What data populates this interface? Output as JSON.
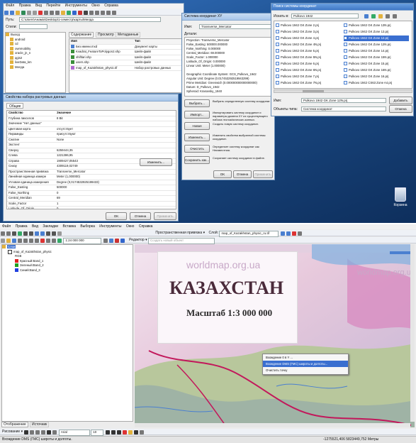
{
  "top": {
    "arccatalog": {
      "menu": [
        "Файл",
        "Правка",
        "Вид",
        "Перейти",
        "Инструменты",
        "Окно",
        "Справка"
      ],
      "path_label": "Путь:",
      "path_value": "C:\\Users\\Анаміх\\Desktop\\1-семестр\\карты\\Мелда",
      "styles_label": "Стили:",
      "tabs": [
        "Содержание",
        "Просмотр",
        "Метаданные"
      ],
      "tree": [
        "Выход",
        "android",
        "cd",
        "ownmobility",
        "oracle_jn_n",
        "qgis2",
        "liveData_km",
        "Мелда"
      ],
      "col_name": "Имя",
      "col_type": "Тип",
      "files": [
        {
          "name": "Без имени.mxd",
          "type": "Документ карты"
        },
        {
          "name": "Kvadrat_FeatureToPolygon2.shp",
          "type": "Шейп-файл"
        },
        {
          "name": "shiftlari.shp",
          "type": "Шейп-файл"
        },
        {
          "name": "users.shp",
          "type": "Шейп-файл"
        },
        {
          "name": "map_of_Kazakhstan_physic.tif",
          "type": "Набор растровых данных"
        }
      ]
    },
    "props": {
      "title": "Свойства набора растровых данных",
      "tab": "Общие",
      "col_prop": "Свойство",
      "col_val": "Значение",
      "rows": [
        {
          "k": "Глубина пикселов",
          "v": "8 Bit"
        },
        {
          "k": "Значение \"Нет данных\"",
          "v": ""
        },
        {
          "k": "Цветовая карта",
          "v": "отсутствует"
        },
        {
          "k": "Пирамиды",
          "v": "присутствуют"
        },
        {
          "k": "Сжатие",
          "v": "None"
        },
        {
          "k": "Экстент",
          "v": ""
        },
        {
          "k": "Сверху",
          "v": "6259444,35"
        },
        {
          "k": "Слева",
          "v": "1221386,95"
        },
        {
          "k": "Справа",
          "v": "1909427,05543"
        },
        {
          "k": "Снизу",
          "v": "4309119,02749"
        },
        {
          "k": "Пространственная привязка",
          "v": "Transverse_Mercator"
        },
        {
          "k": "Линейная единица измере",
          "v": "Meter (1,000000)"
        },
        {
          "k": "Угловая единица измерения",
          "v": "Degree (0,0174532925199433)"
        },
        {
          "k": "False_Easting",
          "v": "500000"
        },
        {
          "k": "False_Northing",
          "v": "0"
        },
        {
          "k": "Central_Meridian",
          "v": "69"
        },
        {
          "k": "Scale_Factor",
          "v": "1"
        },
        {
          "k": "Latitude_Of_Origin",
          "v": "0"
        }
      ],
      "edit_btn": "Изменить...",
      "ok": "OK",
      "cancel": "Отмена",
      "apply": "Применить"
    },
    "coord": {
      "title": "Система координат XY",
      "name_label": "Имя:",
      "name_value": "Transverse_Mercator",
      "details_label": "Детали:",
      "details": [
        "Projection: Transverse_Mercator",
        "False_Easting: 500000.000000",
        "False_Northing: 0.000000",
        "Central_Meridian: 69.000000",
        "Scale_Factor: 1.000000",
        "Latitude_Of_Origin: 0.000000",
        "Linear Unit: Meter (1.000000)",
        "",
        "Geographic Coordinate System: GCS_Pulkovo_1942",
        "Angular Unit: Degree (0.017453292519943299)",
        "Prime Meridian: Greenwich (0.000000000000000000)",
        "Datum: D_Pulkovo_1942",
        "  Spheroid: Krasovsky_1940"
      ],
      "actions": [
        {
          "btn": "Выбрать...",
          "desc": "Выбрать определенную систему координат."
        },
        {
          "btn": "Импорт...",
          "desc": "Импортировать систему координат и параметры домена XY из существующего набора географических данных."
        },
        {
          "btn": "Новая",
          "desc": "Создать новую систему координат."
        },
        {
          "btn": "Изменить...",
          "desc": "Изменить свойства выбранной системы координат."
        },
        {
          "btn": "Очистить",
          "desc": "Определяет систему координат как Неизвестная."
        },
        {
          "btn": "Сохранить как...",
          "desc": "Сохраняет систему координат в файле."
        }
      ],
      "ok": "OK",
      "cancel": "Отмена",
      "apply": "Применить"
    },
    "browse": {
      "title": "Поиск системы координат",
      "look_in_label": "Искать в:",
      "look_in_value": "Pulkovo 1942",
      "items": [
        "Pulkovo 1942 GK Zone 2.prj",
        "Pulkovo 1942 GK Zone 13N.prj",
        "Pulkovo 1942 GK Zone 3.prj",
        "Pulkovo 1942 GK Zone 13.prj",
        "Pulkovo 1942 GK Zone 4.prj",
        "Pulkovo 1942 GK Zone 12.prj",
        "Pulkovo 1942 GK Zone 4N.prj",
        "Pulkovo 1942 GK Zone 12N.prj",
        "Pulkovo 1942 GK Zone 5.prj",
        "Pulkovo 1942 GK Zone 14.prj",
        "Pulkovo 1942 GK Zone 5N.prj",
        "Pulkovo 1942 GK Zone 15N.prj",
        "Pulkovo 1942 GK Zone 6.prj",
        "Pulkovo 1942 GK Zone 15.prj",
        "Pulkovo 1942 GK Zone 6N.prj",
        "Pulkovo 1942 GK Zone 16N.prj",
        "Pulkovo 1942 GK Zone 7.prj",
        "Pulkovo 1942 GK Zone 16.prj",
        "Pulkovo 1942 GK Zone 7N.prj",
        "Pulkovo 1942 CS63 Zone A4.prj"
      ],
      "selected_index": 5,
      "name_label": "Имя:",
      "name_value": "Pulkovo 1942 GK Zone 12N.prj",
      "type_label": "Объекты типа:",
      "type_value": "Система координат",
      "add": "Добавить",
      "cancel": "Отмена"
    },
    "recycle": "Корзина"
  },
  "bottom": {
    "menu": [
      "Файл",
      "Правка",
      "Вид",
      "Закладки",
      "Вставка",
      "Выборка",
      "Инструменты",
      "Окно",
      "Справка"
    ],
    "scale_value": "1:24 000 000",
    "georef_label": "Пространственная привязка ▾",
    "layer_label": "Слой:",
    "layer_value": "map_of_Kazakhstan_physic_ru.tif",
    "editor_label": "Редактор ▾",
    "find_placeholder": "Создать новый объект",
    "toc": {
      "root": "Слои",
      "layer": "map_of_Kazakhstan_physic",
      "rgb": "RGB",
      "bands": [
        {
          "label": "Красный:Band_1",
          "color": "#e02020"
        },
        {
          "label": "Зеленый:Band_2",
          "color": "#20a020"
        },
        {
          "label": "Синий:Band_3",
          "color": "#2040e0"
        }
      ]
    },
    "toc_tabs": [
      "Отображение",
      "Источник"
    ],
    "map": {
      "site": "worldmap.org.ua",
      "title": "КАЗАХСТАН",
      "scale": "Масштаб 1:3 000 000"
    },
    "context_menu": {
      "items": [
        "Вхождение 0 в Y ...",
        "Вхождение DMS (ГМС) широты и долготы...",
        "Очистить точку"
      ],
      "highlighted_index": 1
    },
    "draw_label": "Рисование ▾",
    "font_value": "Arial",
    "font_size": "10",
    "status_left": "Вхождение DMS (ГМС) широты и долготы.",
    "status_right": "-1275521,406  5823449,752 Метры"
  }
}
